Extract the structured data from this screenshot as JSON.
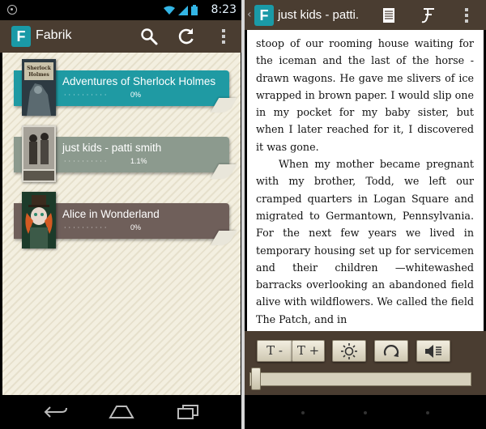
{
  "status": {
    "time": "8:23"
  },
  "app": {
    "name": "Fabrik",
    "logo_letter": "F"
  },
  "library": {
    "books": [
      {
        "title": "Adventures of Sherlock Holmes",
        "progress": "0%",
        "tag_color": "#1f9aa3",
        "cover_title": "Sherlock Holmes"
      },
      {
        "title": "just kids - patti smith",
        "progress": "1.1%",
        "tag_color": "#8c9a8e",
        "cover_title": ""
      },
      {
        "title": "Alice in Wonderland",
        "progress": "0%",
        "tag_color": "#6f5f5a",
        "cover_title": ""
      }
    ]
  },
  "reader": {
    "title": "just kids - patti.",
    "logo_letter": "F",
    "paragraphs": [
      "stoop of our rooming house waiting for the iceman and the last of the horse -drawn wagons. He gave me slivers of ice wrapped in brown paper. I would slip one in my pocket for my baby sister, but when I later reached for it, I discovered it was gone.",
      "When my mother became pregnant with my brother, Todd, we left our cramped quarters in Logan Square and migrated to Germantown, Pennsylvania. For the next few years we lived in temporary housing set up for servicemen and their children —whitewashed barracks overlooking an abandoned field alive with wildflowers. We called the field The Patch, and in"
    ],
    "controls": {
      "font_smaller": "T -",
      "font_larger": "T +"
    },
    "reading_position": 0
  },
  "colors": {
    "bar_brown": "#4a3d31",
    "accent_teal": "#1a9aa7"
  }
}
